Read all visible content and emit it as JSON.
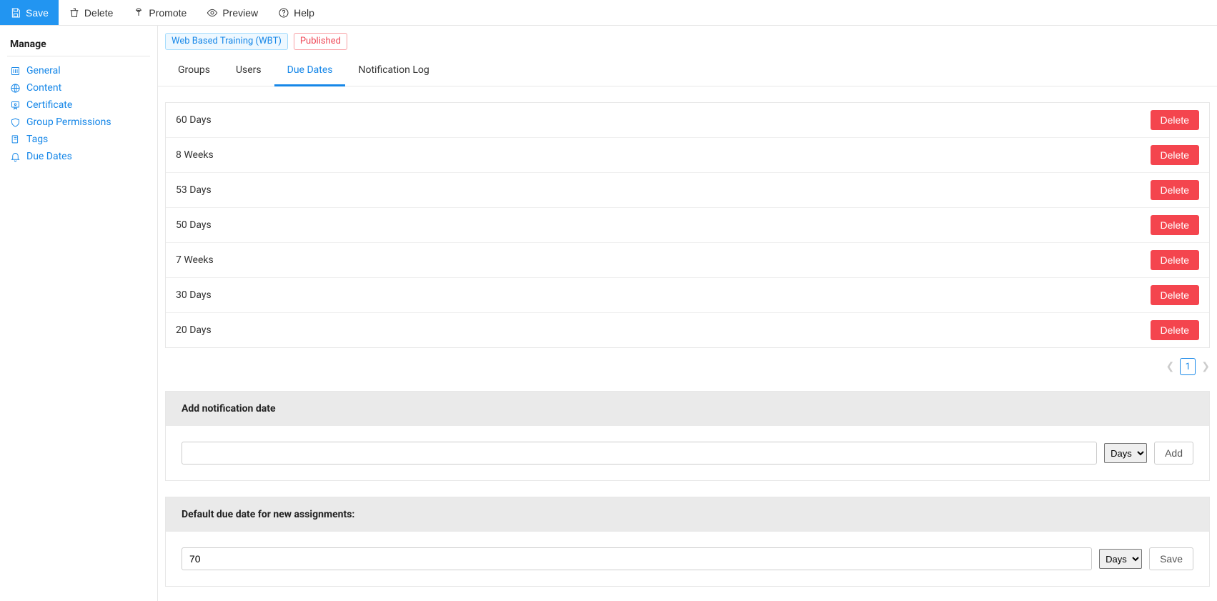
{
  "toolbar": {
    "save_label": "Save",
    "delete_label": "Delete",
    "promote_label": "Promote",
    "preview_label": "Preview",
    "help_label": "Help"
  },
  "sidebar": {
    "heading": "Manage",
    "items": [
      {
        "label": "General"
      },
      {
        "label": "Content"
      },
      {
        "label": "Certificate"
      },
      {
        "label": "Group Permissions"
      },
      {
        "label": "Tags"
      },
      {
        "label": "Due Dates"
      }
    ]
  },
  "badges": {
    "type_label": "Web Based Training (WBT)",
    "status_label": "Published"
  },
  "tabs": [
    {
      "label": "Groups",
      "active": false
    },
    {
      "label": "Users",
      "active": false
    },
    {
      "label": "Due Dates",
      "active": true
    },
    {
      "label": "Notification Log",
      "active": false
    }
  ],
  "due_dates_rows": [
    {
      "label": "60 Days"
    },
    {
      "label": "8 Weeks"
    },
    {
      "label": "53 Days"
    },
    {
      "label": "50 Days"
    },
    {
      "label": "7 Weeks"
    },
    {
      "label": "30 Days"
    },
    {
      "label": "20 Days"
    }
  ],
  "row_delete_label": "Delete",
  "pagination": {
    "current": "1"
  },
  "add_panel": {
    "heading": "Add notification date",
    "input_value": "",
    "unit_selected": "Days",
    "button_label": "Add"
  },
  "default_panel": {
    "heading": "Default due date for new assignments:",
    "input_value": "70",
    "unit_selected": "Days",
    "button_label": "Save"
  }
}
